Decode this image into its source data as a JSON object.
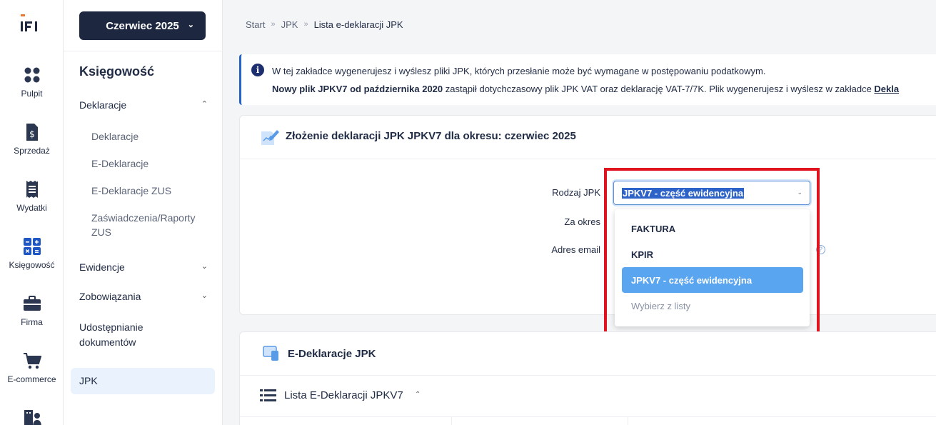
{
  "logo": {
    "text": "IFI"
  },
  "rail": [
    {
      "label": "Pulpit",
      "icon": "dashboard-icon"
    },
    {
      "label": "Sprzedaż",
      "icon": "invoice-dollar-icon"
    },
    {
      "label": "Wydatki",
      "icon": "receipt-icon"
    },
    {
      "label": "Księgowość",
      "icon": "calculator-icon"
    },
    {
      "label": "Firma",
      "icon": "briefcase-icon"
    },
    {
      "label": "E-commerce",
      "icon": "cart-icon"
    },
    {
      "label": "",
      "icon": "buildings-icon"
    }
  ],
  "subnav": {
    "period": "Czerwiec 2025",
    "section_title": "Księgowość",
    "groups": [
      {
        "label": "Deklaracje",
        "expanded": true
      },
      {
        "label": "Ewidencje",
        "expanded": false
      },
      {
        "label": "Zobowiązania",
        "expanded": false
      },
      {
        "label": "Udostępnianie dokumentów"
      },
      {
        "label": "JPK"
      }
    ],
    "sub_items": [
      "Deklaracje",
      "E-Deklaracje",
      "E-Deklaracje ZUS",
      "Zaświadczenia/Raporty ZUS"
    ]
  },
  "breadcrumb": [
    "Start",
    "JPK",
    "Lista e-deklaracji JPK"
  ],
  "info": {
    "line1": "W tej zakładce wygenerujesz i wyślesz pliki JPK, których przesłanie może być wymagane w postępowaniu podatkowym.",
    "line2_bold": "Nowy plik JPKV7 od października 2020",
    "line2_rest": " zastąpił dotychczasowy plik JPK VAT oraz deklarację VAT-7/7K. Plik wygenerujesz i wyślesz w zakładce ",
    "line2_link": "Dekla"
  },
  "card1": {
    "title": "Złożenie deklaracji JPK JPKV7 dla okresu: czerwiec 2025",
    "fields": [
      "Rodzaj JPK",
      "Za okres",
      "Adres email"
    ],
    "select_value": "JPKV7 - część ewidencyjna",
    "options": [
      "FAKTURA",
      "KPIR",
      "JPKV7 - część ewidencyjna",
      "Wybierz z listy"
    ],
    "selected_index": 2
  },
  "card2": {
    "title": "E-Deklaracje JPK",
    "list_title": "Lista E-Deklaracji JPKV7"
  },
  "colors": {
    "accent": "#2563c7",
    "navy": "#1d2740",
    "highlight": "#e0141e",
    "option_selected": "#5aa5f0"
  }
}
